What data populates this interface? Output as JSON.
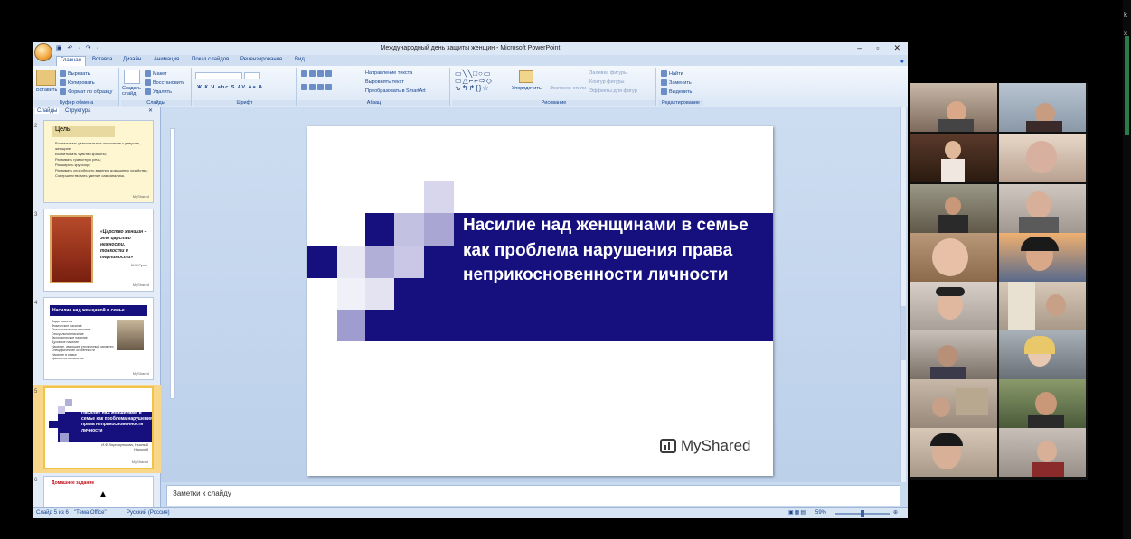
{
  "window": {
    "title": "Международный день защиты женщин - Microsoft PowerPoint",
    "controls": [
      "–",
      "▫",
      "✕"
    ]
  },
  "qat": "▣ ↶ · ↷ ·",
  "tabs": [
    "Главная",
    "Вставка",
    "Дизайн",
    "Анимация",
    "Показ слайдов",
    "Рецензирование",
    "Вид"
  ],
  "ribbon": {
    "clipboard": {
      "label": "Буфер обмена",
      "paste": "Вставить",
      "cut": "Вырезать",
      "copy": "Копировать",
      "format": "Формат по образцу"
    },
    "slides": {
      "label": "Слайды",
      "new": "Создать слайд",
      "layout": "Макет",
      "reset": "Восстановить",
      "delete": "Удалить"
    },
    "font": {
      "label": "Шрифт",
      "buttons": "Ж К Ч abc S AV Аа A"
    },
    "paragraph": {
      "label": "Абзац",
      "direction": "Направление текста",
      "align": "Выровнять текст",
      "smartart": "Преобразовать в SmartArt"
    },
    "drawing": {
      "label": "Рисование",
      "arrange": "Упорядочить",
      "styles": "Экспресс-стили",
      "fill": "Заливка фигуры",
      "outline": "Контур фигуры",
      "effects": "Эффекты для фигур"
    },
    "editing": {
      "label": "Редактирование",
      "find": "Найти",
      "replace": "Заменить",
      "select": "Выделить"
    }
  },
  "panel": {
    "tab_slides": "Слайды",
    "tab_outline": "Структура",
    "thumbs": [
      {
        "num": "2",
        "title": "Цель:",
        "lines": [
          "Воспитывать уважительное отношение к девушке, женщине;",
          "Воспитывать чувство красоты;",
          "Развивать грамотную речь;",
          "Расширять кругозор;",
          "Развивать способность ведения домашнего хозяйства;",
          "Совершенствовать умение самоанализа."
        ],
        "logo": "MyShared"
      },
      {
        "num": "3",
        "quote": "«Царство женщин – это царство нежности, тонкости и терпимости»",
        "author": "Ж.Ж.Руссо",
        "logo": "MyShared"
      },
      {
        "num": "4",
        "title": "Насилие над женщиной в семье",
        "lines": [
          "Виды насилия",
          "Физическое насилие",
          "Психологическое насилие",
          "Сексуальное насилие",
          "Экономическое насилие",
          "Духовное насилие",
          "Насилие, имеющее структурный характер",
          "Специфические особенности",
          "Насилие в семье",
          "Цикличность насилия"
        ],
        "logo": "MyShared"
      },
      {
        "num": "5",
        "title": "Насилие над женщинами в семье как проблема нарушения права неприкосновенности личности",
        "author": "И.Ф.Хорошуткова, Нызный Николай",
        "logo": "MyShared"
      },
      {
        "num": "6",
        "title": "Домашнее задание"
      }
    ]
  },
  "ruler": "·12·|·11·|·10·|·9·|·8·|·7·|·6·|·5·|·4·|·3·|·2·|·1·|·0·|·1·|·2·|·3·|·4·|·5·|·6·|·7·|·8·|·9·|·10·|·11·|·12·",
  "slide": {
    "title": "Насилие над женщинами в семье как проблема нарушения права неприкосновенности личности",
    "logo": "MyShared"
  },
  "notes": {
    "placeholder": "Заметки к слайду"
  },
  "status": {
    "slide": "Слайд 5 из 6",
    "theme": "\"Тема Office\"",
    "lang": "Русский (Россия)",
    "zoom": "59%"
  },
  "colors": {
    "banner": "#16107e",
    "accent": "#f2c34a"
  },
  "edge_letters": [
    "k",
    "х"
  ]
}
